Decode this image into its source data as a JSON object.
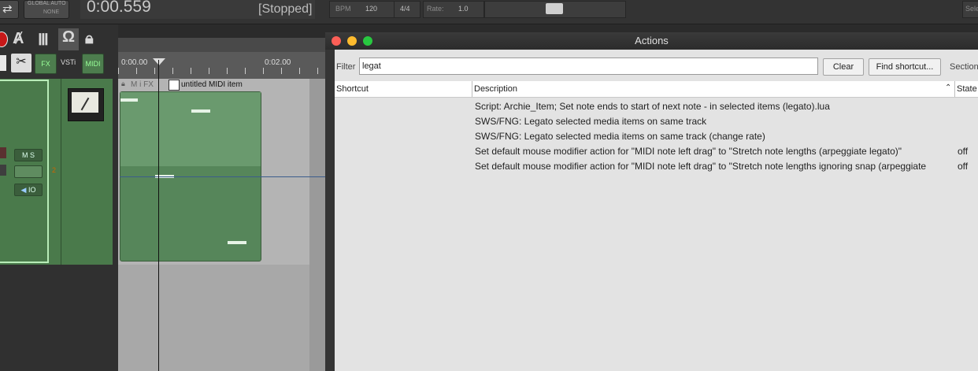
{
  "transport": {
    "global_auto_label": "GLOBAL AUTO",
    "global_auto_value": "NONE",
    "time": "0:00.559",
    "status": "[Stopped]",
    "bpm_label": "BPM",
    "bpm_value": "120",
    "time_sig": "4/4",
    "rate_label": "Rate:",
    "rate_value": "1.0",
    "sel_label": "Sele"
  },
  "track": {
    "fx_label": "FX",
    "vsti_label": "VSTi",
    "midi_label": "MIDI",
    "ms_label": "M S",
    "io_label": "IO",
    "number": "2"
  },
  "ruler": {
    "marker1": "0:00.00",
    "marker2": "0:02.00"
  },
  "item": {
    "name": "untitled MIDI item",
    "flags": "M i FX"
  },
  "actions": {
    "title": "Actions",
    "filter_label": "Filter",
    "filter_value": "legat",
    "clear_label": "Clear",
    "find_shortcut_label": "Find shortcut...",
    "section_label": "Section",
    "columns": {
      "shortcut": "Shortcut",
      "description": "Description",
      "state": "State"
    },
    "rows": [
      {
        "description": "Script: Archie_Item;  Set note ends to start of next note - in selected items (legato).lua",
        "state": ""
      },
      {
        "description": "SWS/FNG: Legato selected media items on same track",
        "state": ""
      },
      {
        "description": "SWS/FNG: Legato selected media items on same track (change rate)",
        "state": ""
      },
      {
        "description": "Set default mouse modifier action for \"MIDI note left drag\" to \"Stretch note lengths (arpeggiate legato)\"",
        "state": "off"
      },
      {
        "description": "Set default mouse modifier action for \"MIDI note left drag\" to \"Stretch note lengths ignoring snap (arpeggiate",
        "state": "off"
      }
    ]
  }
}
